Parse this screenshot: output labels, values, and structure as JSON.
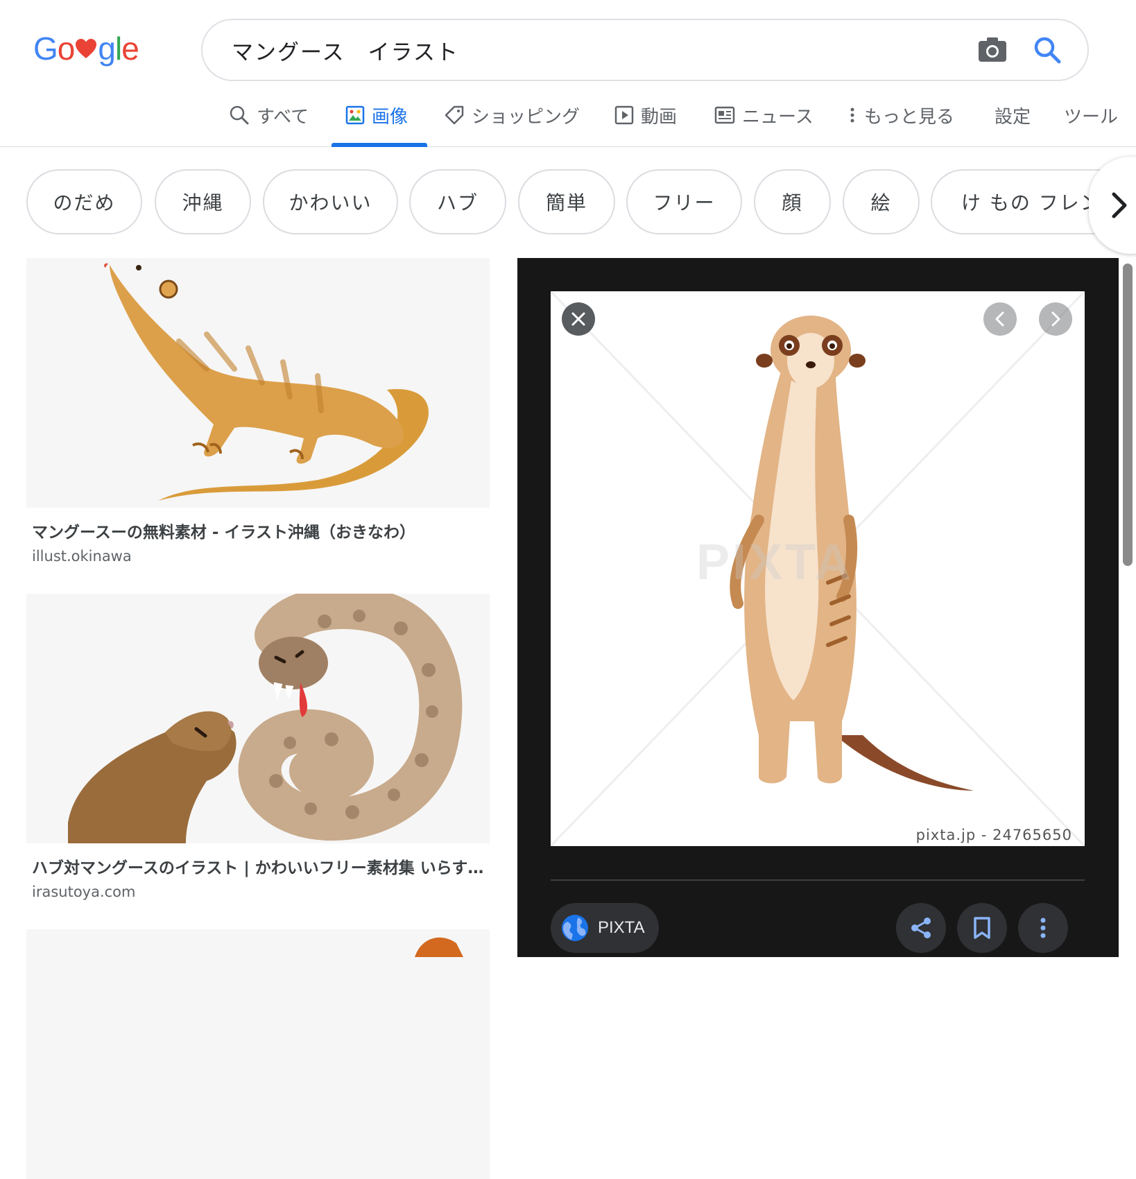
{
  "logo": {
    "text_pre": "Go",
    "text_post": "gle",
    "heart_icon": "heart-icon"
  },
  "search": {
    "query": "マングース　イラスト",
    "camera_icon": "camera-icon",
    "search_icon": "search-icon"
  },
  "tabs": [
    {
      "label": "すべて",
      "icon": "search-icon"
    },
    {
      "label": "画像",
      "icon": "image-icon",
      "active": true
    },
    {
      "label": "ショッピング",
      "icon": "tag-icon"
    },
    {
      "label": "動画",
      "icon": "play-icon"
    },
    {
      "label": "ニュース",
      "icon": "news-icon"
    },
    {
      "label": "もっと見る",
      "icon": "more-vert-icon"
    },
    {
      "label": "設定"
    },
    {
      "label": "ツール"
    }
  ],
  "chips": [
    "のだめ",
    "沖縄",
    "かわいい",
    "ハブ",
    "簡単",
    "フリー",
    "顔",
    "絵",
    "け もの フレンズ"
  ],
  "results": [
    {
      "title": "マングースーの無料素材 - イラスト沖縄（おきなわ）",
      "domain": "illust.okinawa"
    },
    {
      "title": "ハブ対マングースのイラスト | かわいいフリー素材集 いらすとや",
      "domain": "irasutoya.com"
    }
  ],
  "panel": {
    "watermark": "PIXTA",
    "credit": "pixta.jp - 24765650",
    "source_label": "PIXTA",
    "actions": [
      "share-icon",
      "bookmark-icon",
      "more-vert-icon"
    ]
  },
  "colors": {
    "accent": "#1a73e8",
    "panel_bg": "#171717",
    "logo_blue": "#4285f4",
    "logo_red": "#ea4335",
    "logo_yellow": "#fbbc05",
    "logo_green": "#34a853"
  }
}
